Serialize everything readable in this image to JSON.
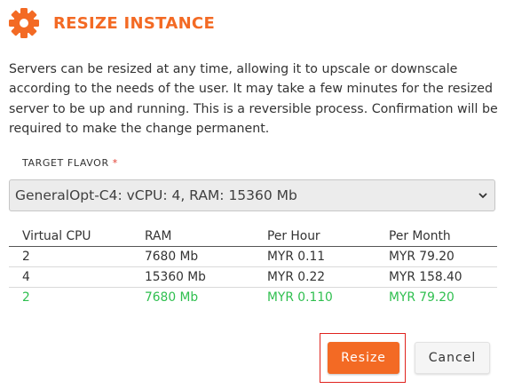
{
  "header": {
    "title": "RESIZE INSTANCE",
    "icon": "gear-icon",
    "accent": "#f36a24"
  },
  "description": "Servers can be resized at any time, allowing it to upscale or downscale according to the needs of the user. It may take a few minutes for the resized server to be up and running. This is a reversible process. Confirmation will be required to make the change permanent.",
  "target_flavor": {
    "label": "TARGET FLAVOR",
    "required_mark": "*",
    "selected": "GeneralOpt-C4: vCPU: 4, RAM: 15360 Mb"
  },
  "table": {
    "headers": [
      "Virtual CPU",
      "RAM",
      "Per Hour",
      "Per Month"
    ],
    "rows": [
      [
        "2",
        "7680 Mb",
        "MYR 0.11",
        "MYR 79.20"
      ],
      [
        "4",
        "15360 Mb",
        "MYR 0.22",
        "MYR 158.40"
      ],
      [
        "2",
        "7680 Mb",
        "MYR 0.110",
        "MYR 79.20"
      ]
    ],
    "highlight_color": "#2fbf4f"
  },
  "buttons": {
    "resize": "Resize",
    "cancel": "Cancel"
  }
}
